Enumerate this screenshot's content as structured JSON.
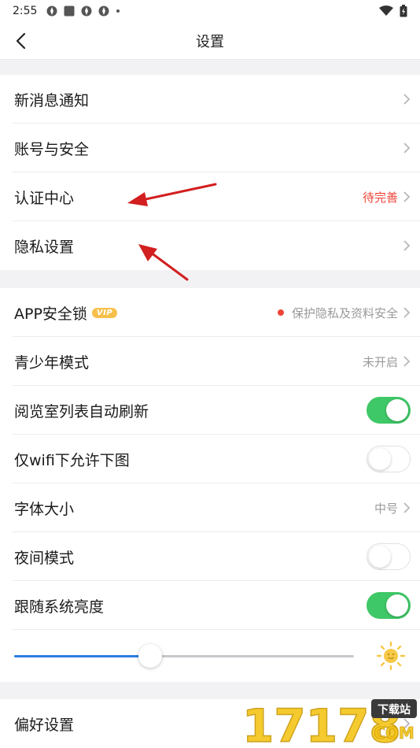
{
  "status_bar": {
    "time": "2:55"
  },
  "header": {
    "title": "设置"
  },
  "section1": {
    "items": [
      {
        "label": "新消息通知"
      },
      {
        "label": "账号与安全"
      },
      {
        "label": "认证中心",
        "value": "待完善"
      },
      {
        "label": "隐私设置"
      }
    ]
  },
  "section2": {
    "app_lock": {
      "label": "APP安全锁",
      "badge": "VIP",
      "value": "保护隐私及资料安全"
    },
    "youth_mode": {
      "label": "青少年模式",
      "value": "未开启"
    },
    "auto_refresh": {
      "label": "阅览室列表自动刷新",
      "on": true
    },
    "wifi_images": {
      "label": "仅wifi下允许下图",
      "on": false
    },
    "font_size": {
      "label": "字体大小",
      "value": "中号"
    },
    "night_mode": {
      "label": "夜间模式",
      "on": false
    },
    "follow_brightness": {
      "label": "跟随系统亮度",
      "on": true
    },
    "brightness_level": 0.4
  },
  "section3": {
    "preferences": {
      "label": "偏好设置"
    }
  },
  "watermark": {
    "main": "17178",
    "tag": "下载站",
    "sub": "COM"
  },
  "colors": {
    "accent_green": "#3fc867",
    "accent_red": "#f04437",
    "slider_blue": "#2a7de1"
  }
}
